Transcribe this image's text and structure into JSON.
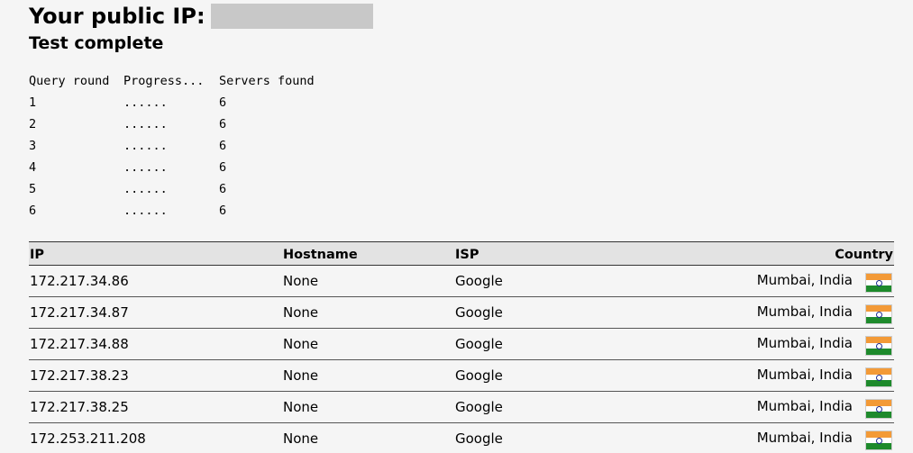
{
  "header": {
    "public_ip_label": "Your public IP:",
    "status": "Test complete"
  },
  "query_log": {
    "headers": [
      "Query round",
      "Progress...",
      "Servers found"
    ],
    "rows": [
      {
        "round": "1",
        "progress": "......",
        "servers": "6"
      },
      {
        "round": "2",
        "progress": "......",
        "servers": "6"
      },
      {
        "round": "3",
        "progress": "......",
        "servers": "6"
      },
      {
        "round": "4",
        "progress": "......",
        "servers": "6"
      },
      {
        "round": "5",
        "progress": "......",
        "servers": "6"
      },
      {
        "round": "6",
        "progress": "......",
        "servers": "6"
      }
    ]
  },
  "results": {
    "columns": [
      "IP",
      "Hostname",
      "ISP",
      "Country"
    ],
    "rows": [
      {
        "ip": "172.217.34.86",
        "hostname": "None",
        "isp": "Google",
        "country": "Mumbai, India",
        "flag": "india-flag-icon"
      },
      {
        "ip": "172.217.34.87",
        "hostname": "None",
        "isp": "Google",
        "country": "Mumbai, India",
        "flag": "india-flag-icon"
      },
      {
        "ip": "172.217.34.88",
        "hostname": "None",
        "isp": "Google",
        "country": "Mumbai, India",
        "flag": "india-flag-icon"
      },
      {
        "ip": "172.217.38.23",
        "hostname": "None",
        "isp": "Google",
        "country": "Mumbai, India",
        "flag": "india-flag-icon"
      },
      {
        "ip": "172.217.38.25",
        "hostname": "None",
        "isp": "Google",
        "country": "Mumbai, India",
        "flag": "india-flag-icon"
      },
      {
        "ip": "172.253.211.208",
        "hostname": "None",
        "isp": "Google",
        "country": "Mumbai, India",
        "flag": "india-flag-icon"
      }
    ]
  },
  "colors": {
    "background": "#f5f5f5",
    "header_row": "#e3e3e3",
    "redaction": "#c8c8c8"
  }
}
